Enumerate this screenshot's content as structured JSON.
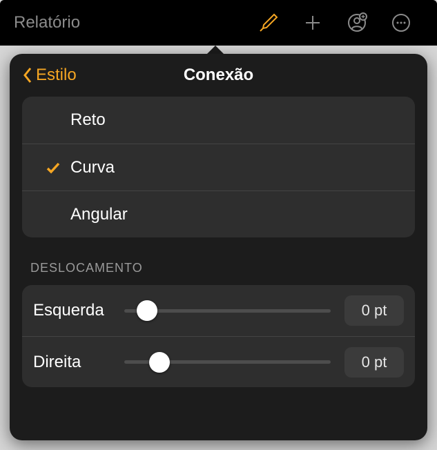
{
  "toolbar": {
    "title": "Relatório"
  },
  "popover": {
    "back_label": "Estilo",
    "title": "Conexão"
  },
  "connection_types": {
    "opt0": "Reto",
    "opt1": "Curva",
    "opt2": "Angular",
    "selected_index": 1
  },
  "offset": {
    "section_label": "DESLOCAMENTO",
    "left_label": "Esquerda",
    "left_value": "0 pt",
    "left_pos_pct": 6,
    "right_label": "Direita",
    "right_value": "0 pt",
    "right_pos_pct": 12
  }
}
